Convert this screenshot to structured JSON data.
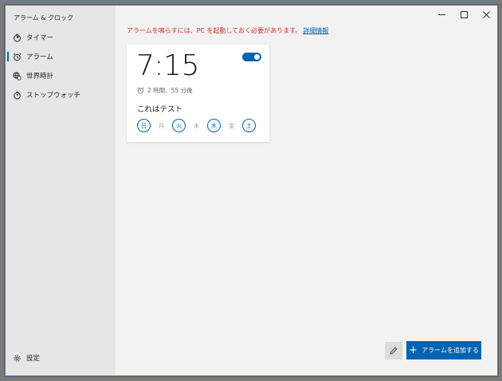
{
  "window": {
    "title": "アラーム & クロック"
  },
  "nav": {
    "items": [
      {
        "label": "タイマー",
        "icon": "timer-icon"
      },
      {
        "label": "アラーム",
        "icon": "alarm-clock-icon",
        "active": true
      },
      {
        "label": "世界時計",
        "icon": "globe-icon"
      },
      {
        "label": "ストップウォッチ",
        "icon": "stopwatch-icon"
      }
    ],
    "settings_label": "設定"
  },
  "warning": {
    "text": "アラームを鳴らすには、PC を起動しておく必要があります。",
    "link": "詳細情報"
  },
  "alarm": {
    "time": "7:15",
    "enabled": true,
    "remaining": "2 時間、55 分後",
    "name": "これはテスト",
    "days": [
      {
        "label": "日",
        "on": true
      },
      {
        "label": "月",
        "on": false
      },
      {
        "label": "火",
        "on": true
      },
      {
        "label": "水",
        "on": false
      },
      {
        "label": "木",
        "on": true
      },
      {
        "label": "金",
        "on": false
      },
      {
        "label": "土",
        "on": true
      }
    ]
  },
  "actions": {
    "add_label": "アラームを追加する"
  },
  "colors": {
    "accent": "#0063b1",
    "warning": "#d32f2f"
  }
}
